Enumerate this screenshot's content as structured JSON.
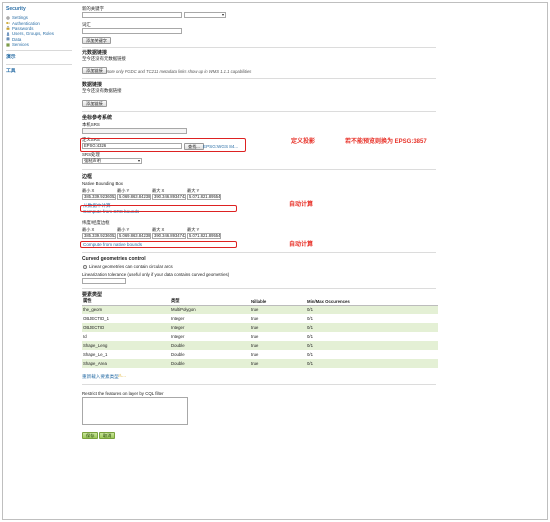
{
  "sidebar": {
    "heading": "Security",
    "items": [
      {
        "label": "Settings",
        "icon": "gear-icon"
      },
      {
        "label": "Authentication",
        "icon": "key-icon"
      },
      {
        "label": "Passwords",
        "icon": "lock-icon"
      },
      {
        "label": "Users, Groups, Roles",
        "icon": "users-icon"
      },
      {
        "label": "Data",
        "icon": "database-icon"
      },
      {
        "label": "Services",
        "icon": "services-icon"
      }
    ],
    "demo_link": "演示",
    "tools_link": "工具"
  },
  "top": {
    "keyword_label": "新的关键字",
    "vocab_label": "词汇",
    "add_keyword_btn": "添加关键字"
  },
  "metadata_links": {
    "title": "元数据链接",
    "empty_text": "至今还没有元数据链接",
    "add_btn": "添加链接",
    "note": "Note only FGDC and TC211 metadata links show up in WMS 1.1.1 capabilities"
  },
  "data_links": {
    "title": "数据链接",
    "empty_text": "至今还没有数据链接",
    "add_btn": "添加链接"
  },
  "crs": {
    "title": "坐标参考系统",
    "native_label": "本机SRS",
    "declared_label": "定义SRS",
    "declared_value": "EPSG:4326",
    "find_btn": "查找...",
    "epsg_link": "EPSG:WGS 84...",
    "policy_label": "SRS处理",
    "policy_value": "强制声明"
  },
  "bounds": {
    "title": "边框",
    "native_label": "Native Bounding Box",
    "latlon_label": "纬度/经度边框",
    "col_headers": [
      "最小 X",
      "最小 Y",
      "最大 X",
      "最大 Y"
    ],
    "native_values": [
      "385.339.9236052",
      "5.069.863.842386",
      "390.346.8934742",
      "5.071.821.895545"
    ],
    "latlon_values": [
      "385.339.9236052",
      "5.069.863.842386",
      "390.346.8934742",
      "5.071.821.895545"
    ],
    "compute_from_data": "从数据中计算",
    "compute_from_srs": "Compute from SRS bounds",
    "compute_from_native": "Compute from native bounds"
  },
  "curved": {
    "title": "Curved geometries control",
    "checkbox_label": "Linear geometries can contain circular arcs",
    "tolerance_label": "Linearization tolerance (useful only if your data contains curved geometries)"
  },
  "feature_type": {
    "title": "要素类型",
    "headers": [
      "属性",
      "类型",
      "Nillable",
      "Min/Max Occurences"
    ],
    "rows": [
      [
        "the_geom",
        "MultiPolygon",
        "true",
        "0/1"
      ],
      [
        "OBJECTID_1",
        "Integer",
        "true",
        "0/1"
      ],
      [
        "OBJECTID",
        "Integer",
        "true",
        "0/1"
      ],
      [
        "Id",
        "Integer",
        "true",
        "0/1"
      ],
      [
        "Shape_Leng",
        "Double",
        "true",
        "0/1"
      ],
      [
        "Shape_Le_1",
        "Double",
        "true",
        "0/1"
      ],
      [
        "Shape_Area",
        "Double",
        "true",
        "0/1"
      ]
    ],
    "reload_link": "重新载入要素类型",
    "warning_marker": "⚠..."
  },
  "cql": {
    "label": "Restrict the features on layer by CQL filter"
  },
  "actions": {
    "save": "保存",
    "cancel": "取消"
  },
  "annotations": {
    "define_projection": "定义投影",
    "preview_note": "若不能预览则换为 EPSG:3857",
    "auto_compute_1": "自动计算",
    "auto_compute_2": "自动计算"
  },
  "colors": {
    "link_blue": "#2a6ea6",
    "row_green": "#e4f0d5",
    "annotation_red": "#e8332a"
  }
}
